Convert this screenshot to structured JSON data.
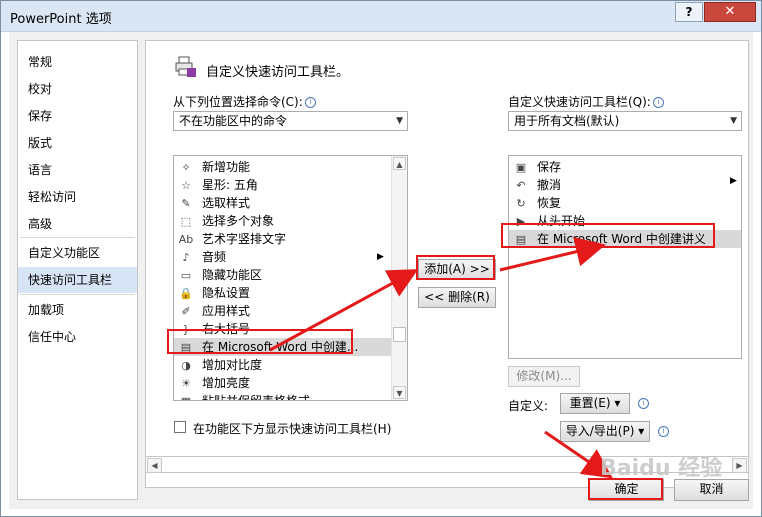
{
  "window": {
    "title": "PowerPoint 选项",
    "help_label": "?",
    "close_label": "✕"
  },
  "nav": {
    "items": [
      {
        "label": "常规"
      },
      {
        "label": "校对"
      },
      {
        "label": "保存"
      },
      {
        "label": "版式"
      },
      {
        "label": "语言"
      },
      {
        "label": "轻松访问"
      },
      {
        "label": "高级"
      },
      {
        "label": "自定义功能区"
      },
      {
        "label": "快速访问工具栏"
      },
      {
        "label": "加载项"
      },
      {
        "label": "信任中心"
      }
    ]
  },
  "header": {
    "title": "自定义快速访问工具栏。"
  },
  "left_panel": {
    "choose_label": "从下列位置选择命令(C):",
    "choose_value": "不在功能区中的命令",
    "commands": [
      {
        "label": "新增功能",
        "icon": "wand-icon"
      },
      {
        "label": "星形: 五角",
        "icon": "star-icon"
      },
      {
        "label": "选取样式",
        "icon": "eyedropper-icon"
      },
      {
        "label": "选择多个对象",
        "icon": "select-objects-icon"
      },
      {
        "label": "艺术字竖排文字",
        "icon": "vertical-text-icon"
      },
      {
        "label": "音频",
        "icon": "audio-icon"
      },
      {
        "label": "隐藏功能区",
        "icon": "hide-ribbon-icon"
      },
      {
        "label": "隐私设置",
        "icon": "lock-icon"
      },
      {
        "label": "应用样式",
        "icon": "apply-style-icon"
      },
      {
        "label": "右大括号",
        "icon": "brace-icon"
      },
      {
        "label": "在 Microsoft Word 中创建...",
        "icon": "word-handout-icon"
      },
      {
        "label": "增加对比度",
        "icon": "contrast-icon"
      },
      {
        "label": "增加亮度",
        "icon": "brightness-icon"
      },
      {
        "label": "粘贴并保留表格格式",
        "icon": "paste-icon"
      }
    ],
    "show_below_label": "在功能区下方显示快速访问工具栏(H)"
  },
  "middle": {
    "add_label": "添加(A) >>",
    "remove_label": "<< 删除(R)"
  },
  "right_panel": {
    "customize_label": "自定义快速访问工具栏(Q):",
    "customize_value": "用于所有文档(默认)",
    "items": [
      {
        "label": "保存",
        "icon": "save-icon"
      },
      {
        "label": "撤消",
        "icon": "undo-icon"
      },
      {
        "label": "恢复",
        "icon": "redo-icon"
      },
      {
        "label": "从头开始",
        "icon": "slideshow-icon"
      },
      {
        "label": "在 Microsoft Word 中创建讲义",
        "icon": "word-handout-icon"
      }
    ],
    "modify_label": "修改(M)...",
    "customize_row_label": "自定义:",
    "reset_label": "重置(E) ▾",
    "import_export_label": "导入/导出(P) ▾"
  },
  "footer": {
    "ok_label": "确定",
    "cancel_label": "取消"
  },
  "watermark": "Baidu 经验",
  "colors": {
    "highlight": "#e41a1a",
    "nav_active": "#d6e4f5",
    "selected": "#d9d9d9"
  }
}
